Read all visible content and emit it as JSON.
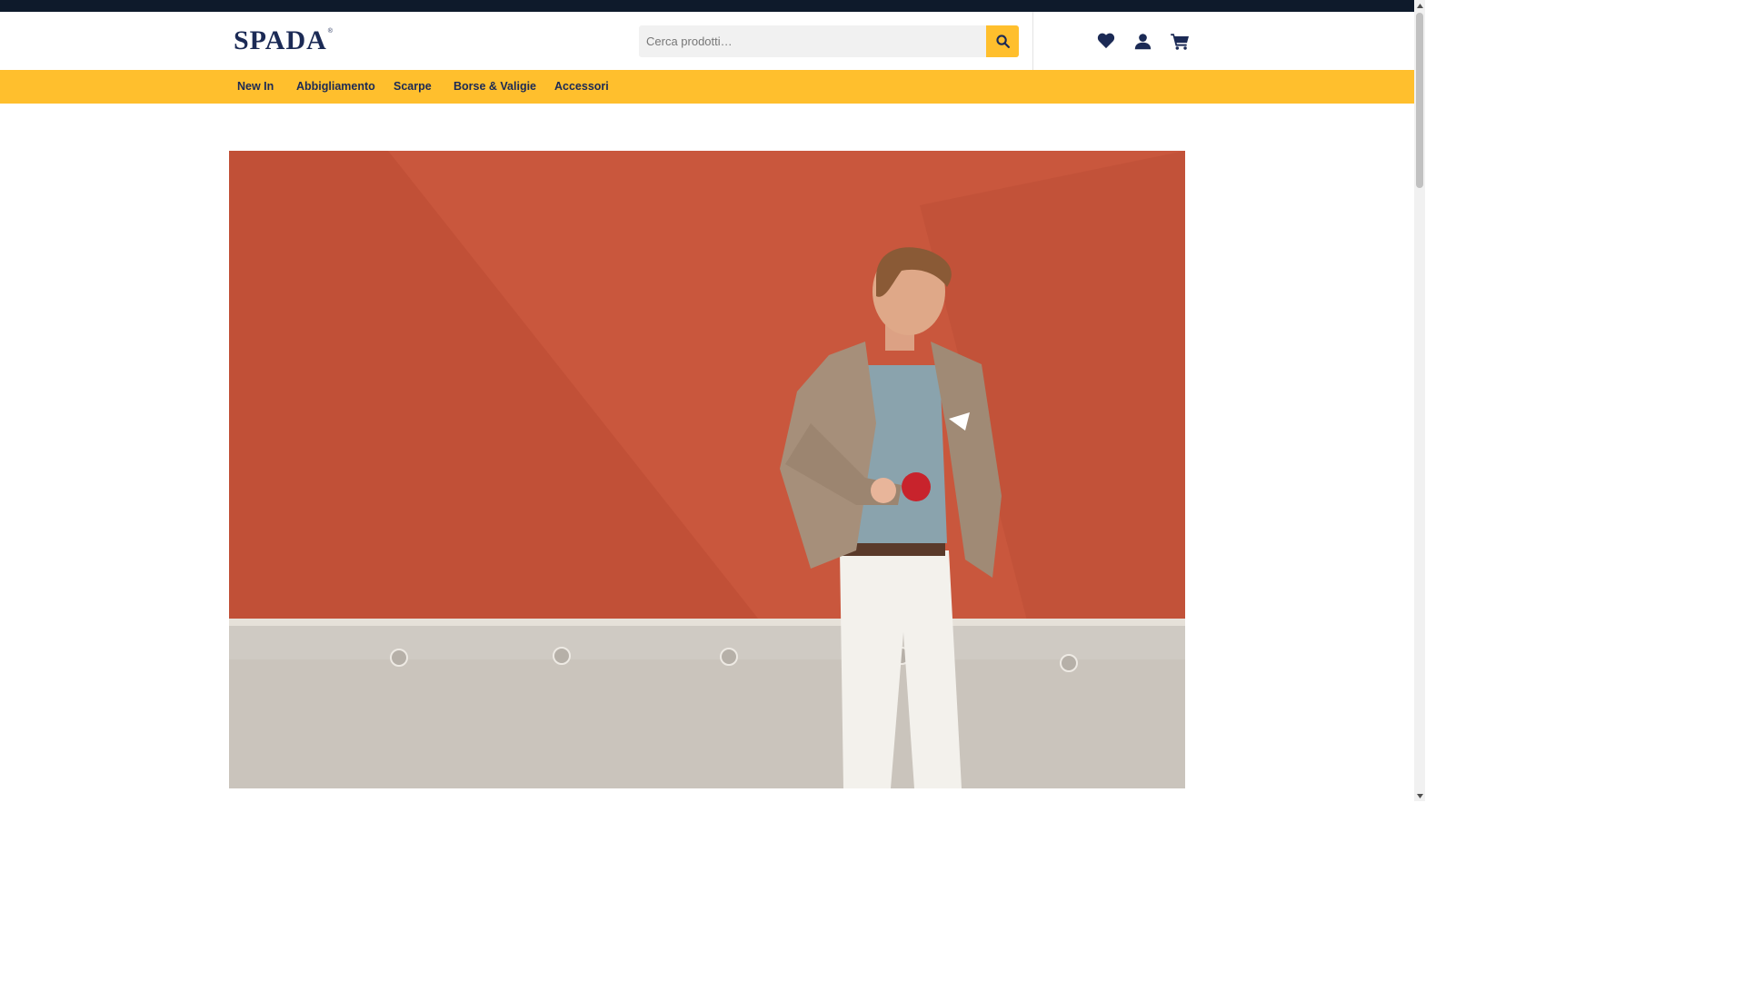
{
  "brand": {
    "name": "SPADA",
    "reg": "®"
  },
  "search": {
    "placeholder": "Cerca prodotti…",
    "value": "",
    "button_icon": "search-icon"
  },
  "header_icons": [
    {
      "name": "wishlist",
      "icon": "heart-icon"
    },
    {
      "name": "account",
      "icon": "user-icon"
    },
    {
      "name": "cart",
      "icon": "cart-icon"
    }
  ],
  "nav": {
    "items": [
      {
        "label": "New In"
      },
      {
        "label": "Abbigliamento"
      },
      {
        "label": "Scarpe"
      },
      {
        "label": "Borse & Valigie"
      },
      {
        "label": "Accessori"
      }
    ]
  },
  "hero": {
    "image": "man-in-jacket-against-red-wall-photo"
  },
  "colors": {
    "topbar": "#0e1a2b",
    "accent": "#ffbf2d",
    "brand": "#1b2a55",
    "wall": "#c4553a"
  }
}
